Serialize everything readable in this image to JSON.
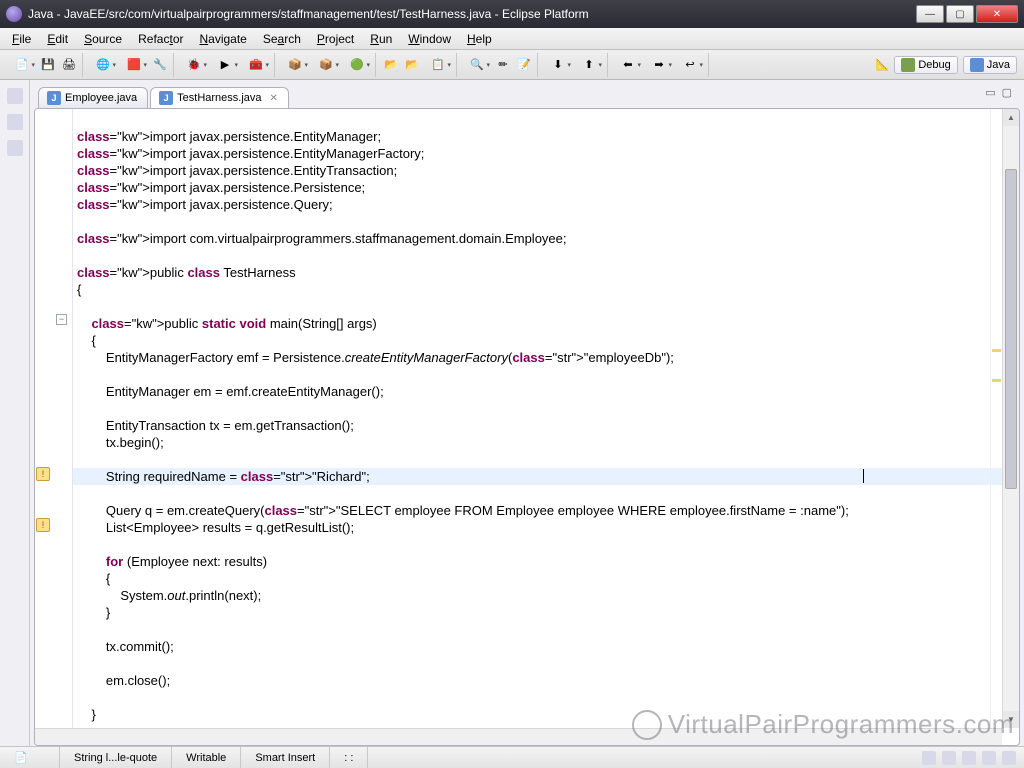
{
  "window": {
    "title": "Java - JavaEE/src/com/virtualpairprogrammers/staffmanagement/test/TestHarness.java - Eclipse Platform"
  },
  "menu": {
    "items": [
      "File",
      "Edit",
      "Source",
      "Refactor",
      "Navigate",
      "Search",
      "Project",
      "Run",
      "Window",
      "Help"
    ]
  },
  "perspectives": {
    "debug": "Debug",
    "java": "Java"
  },
  "tabs": [
    {
      "label": "Employee.java",
      "active": false
    },
    {
      "label": "TestHarness.java",
      "active": true
    }
  ],
  "code": {
    "lines": [
      "",
      "import javax.persistence.EntityManager;",
      "import javax.persistence.EntityManagerFactory;",
      "import javax.persistence.EntityTransaction;",
      "import javax.persistence.Persistence;",
      "import javax.persistence.Query;",
      "",
      "import com.virtualpairprogrammers.staffmanagement.domain.Employee;",
      "",
      "public class TestHarness",
      "{",
      "",
      "    public static void main(String[] args)",
      "    {",
      "        EntityManagerFactory emf = Persistence.createEntityManagerFactory(\"employeeDb\");",
      "",
      "        EntityManager em = emf.createEntityManager();",
      "",
      "        EntityTransaction tx = em.getTransaction();",
      "        tx.begin();",
      "",
      "        String requiredName = \"Richard\";",
      "",
      "        Query q = em.createQuery(\"SELECT employee FROM Employee employee WHERE employee.firstName = :name\");",
      "        List<Employee> results = q.getResultList();",
      "",
      "        for (Employee next: results)",
      "        {",
      "            System.out.println(next);",
      "        }",
      "",
      "        tx.commit();",
      "",
      "        em.close();",
      "",
      "    }"
    ],
    "highlighted_line_index": 21
  },
  "status": {
    "context": "String l...le-quote",
    "mode": "Writable",
    "insert": "Smart Insert",
    "position": ": :"
  },
  "watermark": "VirtualPairProgrammers.com"
}
